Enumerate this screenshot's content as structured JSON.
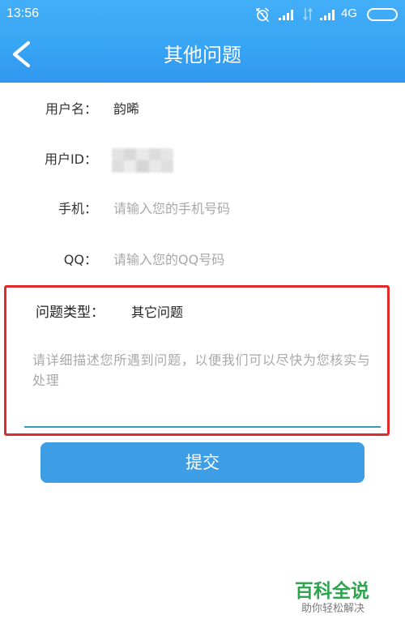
{
  "status_bar": {
    "time": "13:56",
    "network_type": "4G",
    "icons": [
      "alarm-off-icon",
      "signal-icon",
      "data-transfer-icon",
      "signal-icon",
      "battery-icon"
    ]
  },
  "header": {
    "title": "其他问题",
    "back_icon": "chevron-left-icon"
  },
  "form": {
    "username": {
      "label": "用户名：",
      "value": "韵晞"
    },
    "user_id": {
      "label": "用户ID："
    },
    "phone": {
      "label": "手机：",
      "value": "",
      "placeholder": "请输入您的手机号码"
    },
    "qq": {
      "label": "QQ：",
      "value": "",
      "placeholder": "请输入您的QQ号码"
    },
    "issue_type": {
      "label": "问题类型：",
      "value": "其它问题"
    },
    "description": {
      "value": "",
      "placeholder": "请详细描述您所遇到问题，以便我们可以尽快为您核实与处理"
    }
  },
  "submit_button": {
    "label": "提交"
  },
  "watermark": {
    "brand": "百科全说",
    "slogan": "助你轻松解决"
  },
  "colors": {
    "header_blue": "#3aa7f5",
    "button_blue": "#3d9ee5",
    "annotation_red": "#e12a2a",
    "input_underline": "#3a9bb3",
    "watermark_green": "#2ea44f",
    "placeholder_gray": "#a8a8a8"
  }
}
